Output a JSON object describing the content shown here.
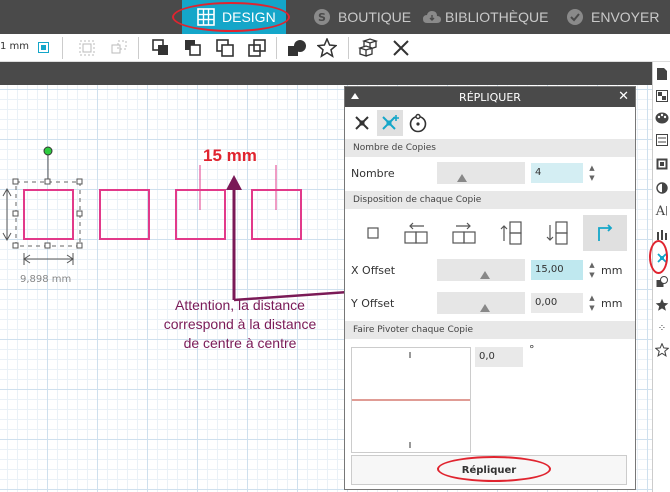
{
  "nav": {
    "design": "DESIGN",
    "boutique": "BOUTIQUE",
    "bibliotheque": "BIBLIOTHÈQUE",
    "envoyer": "ENVOYER"
  },
  "toolbar": {
    "unit_value": "1 mm"
  },
  "canvas": {
    "dimension_label": "9,898 mm"
  },
  "annotations": {
    "distance": "15 mm",
    "note_line1": "Attention, la distance",
    "note_line2": "correspond à la distance",
    "note_line3": "de centre à centre"
  },
  "dialog": {
    "title": "RÉPLIQUER",
    "copies_section": "Nombre de Copies",
    "nombre_label": "Nombre",
    "nombre_value": "4",
    "disposition_section": "Disposition de chaque Copie",
    "x_offset_label": "X Offset",
    "x_offset_value": "15,00",
    "x_unit": "mm",
    "y_offset_label": "Y Offset",
    "y_offset_value": "0,00",
    "y_unit": "mm",
    "rotate_section": "Faire Pivoter chaque Copie",
    "rotate_value": "0,0",
    "rotate_unit": "°",
    "replicate_button": "Répliquer"
  },
  "colors": {
    "accent": "#14a6c9",
    "shape_stroke": "#e23a8a",
    "annotation_red": "#e0242f",
    "annotation_purple": "#7a1a57"
  }
}
